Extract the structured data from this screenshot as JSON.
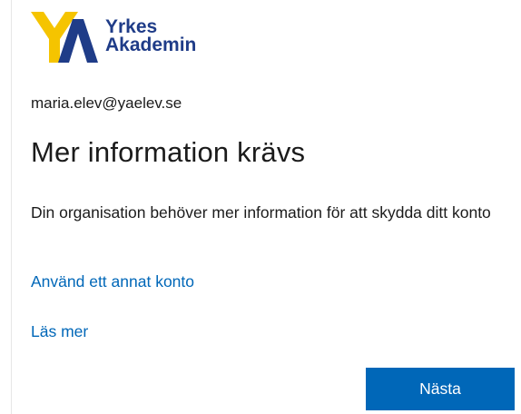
{
  "logo": {
    "line1": "Yrkes",
    "line2": "Akademin",
    "colors": {
      "yellow": "#f5c400",
      "blue": "#1f3c88"
    }
  },
  "account": {
    "email": "maria.elev@yaelev.se"
  },
  "heading": "Mer information krävs",
  "description": "Din organisation behöver mer information för att skydda ditt konto",
  "links": {
    "other_account": "Använd ett annat konto",
    "read_more": "Läs mer"
  },
  "actions": {
    "next_label": "Nästa"
  },
  "colors": {
    "accent": "#0067b8",
    "text": "#1b1b1b",
    "background": "#ffffff"
  }
}
